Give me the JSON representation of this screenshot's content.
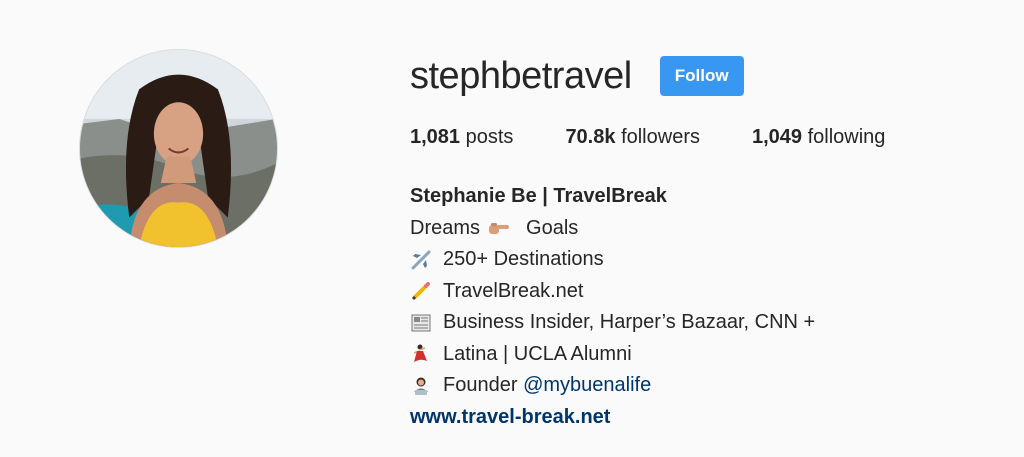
{
  "profile": {
    "username": "stephbetravel",
    "follow_label": "Follow",
    "stats": {
      "posts_count": "1,081",
      "posts_label": "posts",
      "followers_count": "70.8k",
      "followers_label": "followers",
      "following_count": "1,049",
      "following_label": "following"
    },
    "bio": {
      "full_name": "Stephanie Be | TravelBreak",
      "line1_a": "Dreams",
      "line1_icon": "pointing-hand-icon",
      "line1_b": "Goals",
      "line2_icon": "airplane-icon",
      "line2": "250+ Destinations",
      "line3_icon": "pencil-icon",
      "line3": "TravelBreak.net",
      "line4_icon": "newspaper-icon",
      "line4": "Business Insider, Harper’s Bazaar, CNN +",
      "line5_icon": "dancer-icon",
      "line5": "Latina | UCLA Alumni",
      "line6_icon": "woman-technologist-icon",
      "line6_prefix": "Founder",
      "line6_mention": "@mybuenalife",
      "website": "www.travel-break.net"
    }
  },
  "colors": {
    "background": "#fafafa",
    "follow_button": "#3897f0",
    "link": "#003569",
    "text": "#262626"
  }
}
